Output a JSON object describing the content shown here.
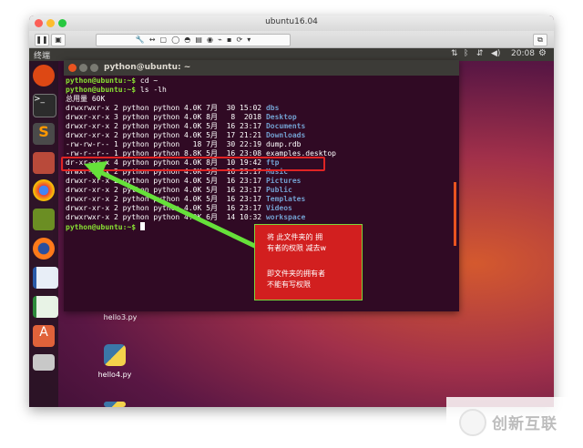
{
  "window": {
    "title": "ubuntu16.04"
  },
  "topbar": {
    "app_name": "终端",
    "time": "20:08"
  },
  "terminal": {
    "title": "python@ubuntu: ~",
    "prompt": "python@ubuntu:~$",
    "lines": [
      {
        "prompt": "python@ubuntu:~$",
        "text": " cd ~"
      },
      {
        "prompt": "python@ubuntu:~$",
        "text": " ls -lh"
      },
      {
        "text": "总用量 60K"
      },
      {
        "meta": "drwxrwxr-x 2 python python 4.0K 7月  30 15:02",
        "name": "dbs",
        "color": "b"
      },
      {
        "meta": "drwxr-xr-x 3 python python 4.0K 8月   8  2018",
        "name": "Desktop",
        "color": "b"
      },
      {
        "meta": "drwxr-xr-x 2 python python 4.0K 5月  16 23:17",
        "name": "Documents",
        "color": "b"
      },
      {
        "meta": "drwxr-xr-x 2 python python 4.0K 5月  17 21:21",
        "name": "Downloads",
        "color": "b"
      },
      {
        "meta": "-rw-rw-r-- 1 python python   18 7月  30 22:19",
        "name": "dump.rdb",
        "color": "w"
      },
      {
        "meta": "-rw-r--r-- 1 python python 8.8K 5月  16 23:08",
        "name": "examples.desktop",
        "color": "w"
      },
      {
        "meta": "dr-xr-xr-x 4 python python 4.0K 8月  10 19:42",
        "name": "ftp",
        "color": "b"
      },
      {
        "meta": "drwxr-xr-x 2 python python 4.0K 5月  16 23:17",
        "name": "Music",
        "color": "b"
      },
      {
        "meta": "drwxr-xr-x 2 python python 4.0K 5月  16 23:17",
        "name": "Pictures",
        "color": "b"
      },
      {
        "meta": "drwxr-xr-x 2 python python 4.0K 5月  16 23:17",
        "name": "Public",
        "color": "b"
      },
      {
        "meta": "drwxr-xr-x 2 python python 4.0K 5月  16 23:17",
        "name": "Templates",
        "color": "b"
      },
      {
        "meta": "drwxr-xr-x 2 python python 4.0K 5月  16 23:17",
        "name": "Videos",
        "color": "b"
      },
      {
        "meta": "drwxrwxr-x 2 python python 4.0K 6月  14 10:32",
        "name": "workspace",
        "color": "b"
      },
      {
        "prompt": "python@ubuntu:~$",
        "text": " "
      }
    ]
  },
  "annotation": {
    "line1": "将 此文件夹的 拥",
    "line2": "有者的权限 减去w",
    "line3": "即文件夹的拥有者",
    "line4": "不能有写权限"
  },
  "desktop": {
    "files": [
      {
        "label": "hello3.py"
      },
      {
        "label": "hello4.py"
      }
    ]
  },
  "watermark": {
    "text": "创新互联"
  },
  "colors": {
    "highlight": "#e02424",
    "arrow": "#66e03a",
    "prompt": "#8ae234",
    "dir": "#729fcf"
  }
}
